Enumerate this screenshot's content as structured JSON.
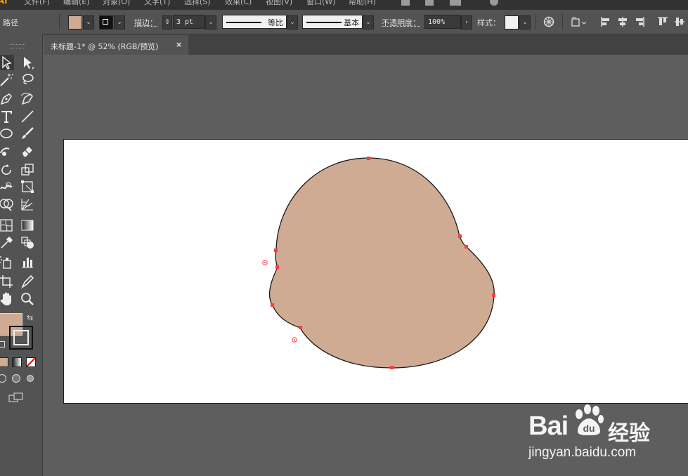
{
  "menubar": {
    "logo": "Ai",
    "items": [
      "文件(F)",
      "编辑(E)",
      "对象(O)",
      "文字(T)",
      "选择(S)",
      "效果(C)",
      "视图(V)",
      "窗口(W)",
      "帮助(H)"
    ]
  },
  "control": {
    "object_type": "路径",
    "fill_color": "#cfab94",
    "stroke_label": "描边：",
    "stroke_value": "3 pt",
    "profile_label": "等比",
    "brush_label": "基本",
    "opacity_label": "不透明度：",
    "opacity_value": "100%",
    "style_label": "样式："
  },
  "document": {
    "tab_title": "未标题-1* @ 52% (RGB/预览)",
    "close": "×"
  },
  "shape": {
    "fill": "#cfab94",
    "stroke": "#1a1a1a",
    "anchor_color": "#ff3c3c"
  },
  "watermark": {
    "brand": "Bai",
    "brand_cn": "经验",
    "url": "jingyan.baidu.com"
  },
  "icons": [
    "selection-icon",
    "direct-selection-icon",
    "magic-wand-icon",
    "lasso-icon",
    "pen-icon",
    "curvature-icon",
    "type-icon",
    "line-icon",
    "ellipse-icon",
    "paintbrush-icon",
    "shaper-icon",
    "eraser-icon",
    "rotate-icon",
    "scale-icon",
    "warp-icon",
    "free-transform-icon",
    "shape-builder-icon",
    "perspective-grid-icon",
    "mesh-icon",
    "gradient-icon",
    "eyedropper-icon",
    "blend-icon",
    "symbol-sprayer-icon",
    "column-graph-icon",
    "artboard-icon",
    "slice-icon",
    "hand-icon",
    "zoom-icon"
  ]
}
